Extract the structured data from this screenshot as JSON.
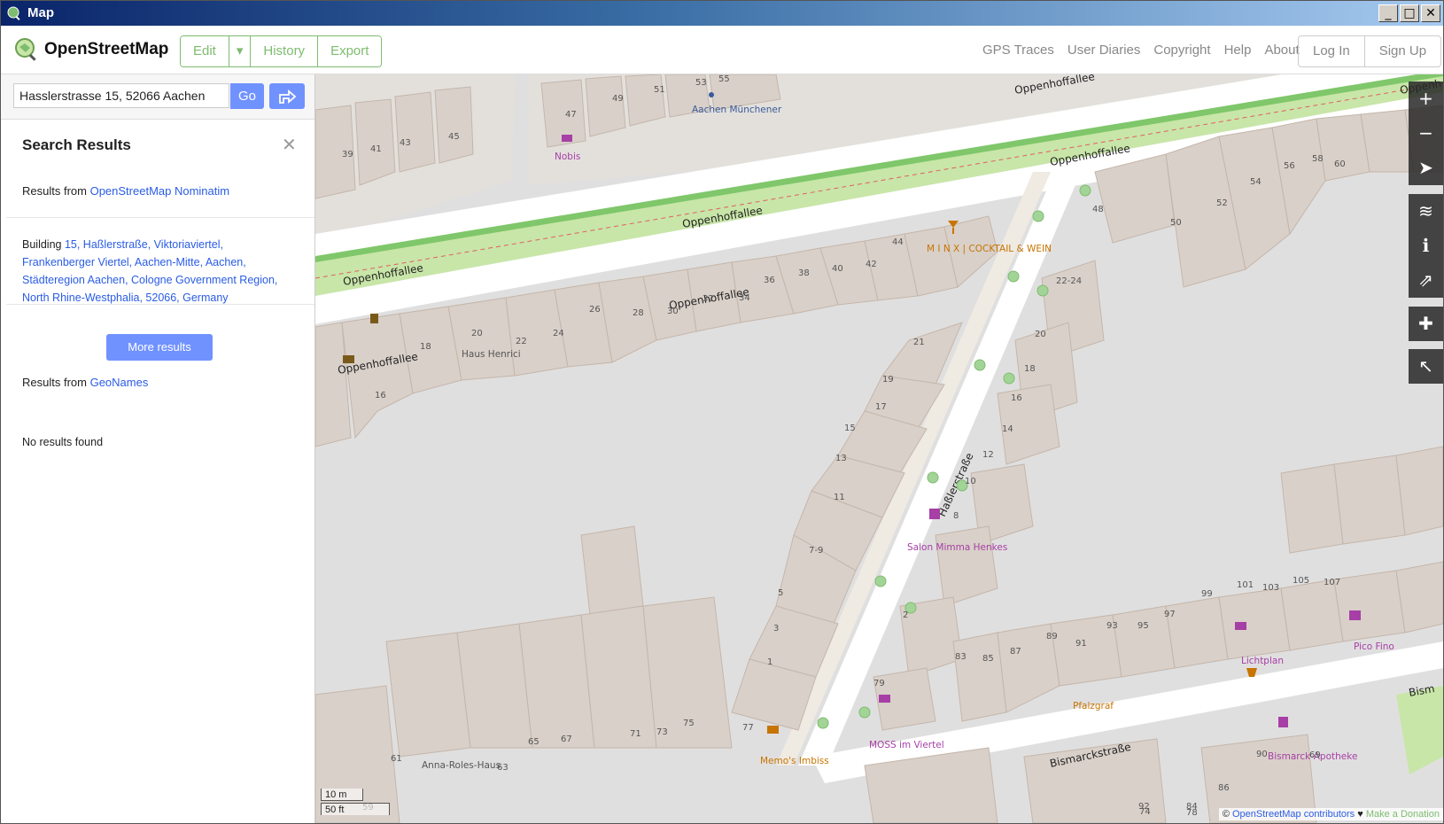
{
  "window": {
    "title": "Map"
  },
  "header": {
    "brand": "OpenStreetMap",
    "edit_label": "Edit",
    "history_label": "History",
    "export_label": "Export",
    "links": [
      "GPS Traces",
      "User Diaries",
      "Copyright",
      "Help",
      "About"
    ],
    "login_label": "Log In",
    "signup_label": "Sign Up"
  },
  "search": {
    "query": "Hasslerstrasse 15, 52066 Aachen",
    "go_label": "Go"
  },
  "results": {
    "title": "Search Results",
    "nominatim_prefix": "Results from ",
    "nominatim_link": "OpenStreetMap Nominatim",
    "item_type": "Building ",
    "item_address": "15, Haßlerstraße, Viktoriaviertel, Frankenberger Viertel, Aachen-Mitte, Aachen, Städteregion Aachen, Cologne Government Region, North Rhine-Westphalia, 52066, Germany",
    "more_label": "More results",
    "geonames_prefix": "Results from ",
    "geonames_link": "GeoNames",
    "no_results": "No results found"
  },
  "map": {
    "streets": {
      "oppenhoffallee": "Oppenhoffallee",
      "hasslerstrasse": "Haßlerstraße",
      "bismarckstrasse": "Bismarckstraße",
      "oppen_cut": "Oppenh",
      "bism_cut": "Bism"
    },
    "pois": {
      "nobis": "Nobis",
      "aachen_muenchener": "Aachen Münchener",
      "minx": "M I N X | COCKTAIL & WEIN",
      "haus_henrici": "Haus Henrici",
      "salon": "Salon Mimma Henkes",
      "lichtplan": "Lichtplan",
      "pico_fino": "Pico Fino",
      "pfalzgraf": "Pfalzgraf",
      "moss": "MOSS im Viertel",
      "memos": "Memo's Imbiss",
      "bismarck_apotheke": "Bismarck-Apotheke",
      "anna_roles": "Anna-Roles-Haus"
    },
    "house_numbers": [
      "39",
      "41",
      "43",
      "45",
      "47",
      "49",
      "51",
      "53",
      "55",
      "18",
      "20",
      "22",
      "24",
      "26",
      "28",
      "30",
      "32",
      "34",
      "36",
      "38",
      "40",
      "42",
      "44",
      "16",
      "21",
      "19",
      "17",
      "15",
      "13",
      "11",
      "7-9",
      "5",
      "3",
      "1",
      "48",
      "50",
      "52",
      "54",
      "56",
      "58",
      "60",
      "22-24",
      "20",
      "18",
      "16",
      "14",
      "12",
      "10",
      "8",
      "2",
      "79",
      "83",
      "85",
      "87",
      "89",
      "91",
      "93",
      "95",
      "97",
      "99",
      "101",
      "103",
      "105",
      "107",
      "71",
      "73",
      "75",
      "77",
      "61",
      "63",
      "65",
      "67",
      "69",
      "90",
      "92",
      "84",
      "86",
      "78",
      "74",
      "59"
    ],
    "scale": {
      "metric": "10 m",
      "imperial": "50 ft"
    },
    "attribution": {
      "prefix": "© ",
      "link": "OpenStreetMap contributors",
      "heart": " ♥ ",
      "donate": "Make a Donation"
    },
    "colors": {
      "building": "#d9d0c9",
      "building_stroke": "#c4b6ab",
      "landuse": "#e0dfdf",
      "grass": "#c8e6a8",
      "road": "#ffffff",
      "accent": "#7ebc6f",
      "button": "#7092ff"
    }
  }
}
